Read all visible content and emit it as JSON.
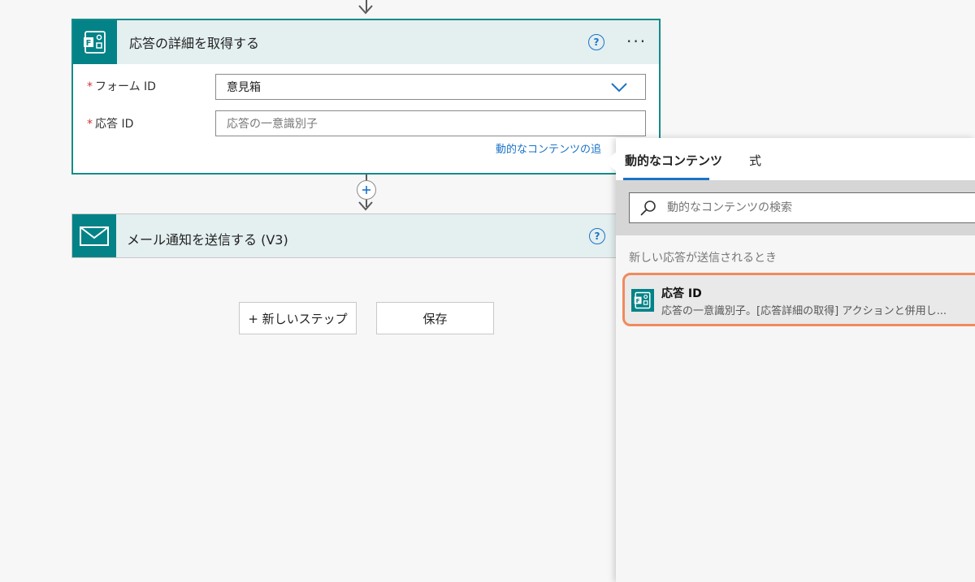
{
  "get_response_card": {
    "title": "応答の詳細を取得する",
    "help_icon": "?",
    "more_icon": "···",
    "form_id": {
      "required_mark": "*",
      "label": "フォーム ID",
      "value": "意見箱"
    },
    "response_id": {
      "required_mark": "*",
      "label": "応答 ID",
      "placeholder": "応答の一意識別子"
    },
    "dynamic_content_link": "動的なコンテンツの追"
  },
  "mail_card": {
    "title": "メール通知を送信する (V3)",
    "help_icon": "?"
  },
  "buttons": {
    "new_step": "+ 新しいステップ",
    "save": "保存"
  },
  "panel": {
    "tabs": [
      {
        "label": "動的なコンテンツ",
        "active": true
      },
      {
        "label": "式",
        "active": false
      }
    ],
    "search_placeholder": "動的なコンテンツの検索",
    "section_label": "新しい応答が送信されるとき",
    "items": [
      {
        "name": "応答 ID",
        "description": "応答の一意識別子。[応答詳細の取得] アクションと併用し..."
      }
    ]
  },
  "colors": {
    "teal": "#038387",
    "accent_blue": "#1a73c8",
    "highlight_orange": "#f08a5d",
    "required_red": "#d13438"
  },
  "icons": [
    "forms-icon",
    "mail-icon",
    "help-icon",
    "more-icon",
    "chevron-down-icon",
    "search-icon",
    "plus-icon",
    "arrow-down-icon"
  ]
}
